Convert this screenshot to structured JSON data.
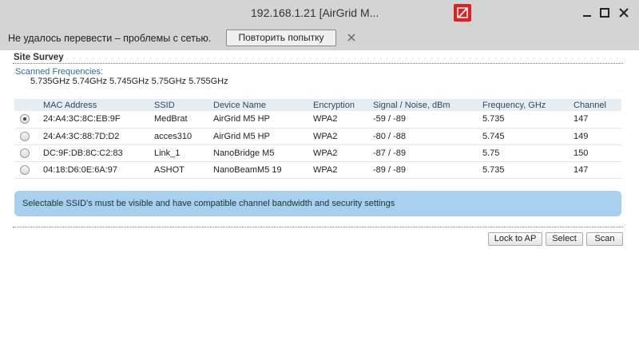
{
  "window": {
    "title": "192.168.1.21  [AirGrid M..."
  },
  "infobar": {
    "message": "Не удалось перевести – проблемы с сетью.",
    "retry_label": "Повторить попытку",
    "close_icon": "close-icon"
  },
  "survey": {
    "section_title": "Site Survey",
    "freq_label": "Scanned Frequencies:",
    "freq_values": "5.735GHz 5.74GHz 5.745GHz 5.75GHz 5.755GHz",
    "columns": [
      "MAC Address",
      "SSID",
      "Device Name",
      "Encryption",
      "Signal / Noise, dBm",
      "Frequency, GHz",
      "Channel"
    ],
    "rows": [
      {
        "selected": true,
        "mac": "24:A4:3C:8C:EB:9F",
        "ssid": "MedBrat",
        "device": "AirGrid M5 HP",
        "enc": "WPA2",
        "signal": "-59 / -89",
        "freq": "5.735",
        "channel": "147"
      },
      {
        "selected": false,
        "mac": "24:A4:3C:88:7D:D2",
        "ssid": "acces310",
        "device": "AirGrid M5 HP",
        "enc": "WPA2",
        "signal": "-80 / -88",
        "freq": "5.745",
        "channel": "149"
      },
      {
        "selected": false,
        "mac": "DC:9F:DB:8C:C2:83",
        "ssid": "Link_1",
        "device": "NanoBridge M5",
        "enc": "WPA2",
        "signal": "-87 / -89",
        "freq": "5.75",
        "channel": "150"
      },
      {
        "selected": false,
        "mac": "04:18:D6:0E:6A:97",
        "ssid": "ASHOT",
        "device": "NanoBeamM5 19",
        "enc": "WPA2",
        "signal": "-89 / -89",
        "freq": "5.735",
        "channel": "147"
      }
    ],
    "note": "Selectable SSID's must be visible and have compatible channel bandwidth and security settings",
    "buttons": {
      "lock_label": "Lock to AP",
      "select_label": "Select",
      "scan_label": "Scan"
    }
  },
  "colors": {
    "titlebar_bg": "#d4d4d4",
    "note_bg": "#a6d0ee",
    "header_bg": "#e7eef3",
    "link_blue": "#2d6ca5",
    "blocked_red": "#e02020"
  }
}
